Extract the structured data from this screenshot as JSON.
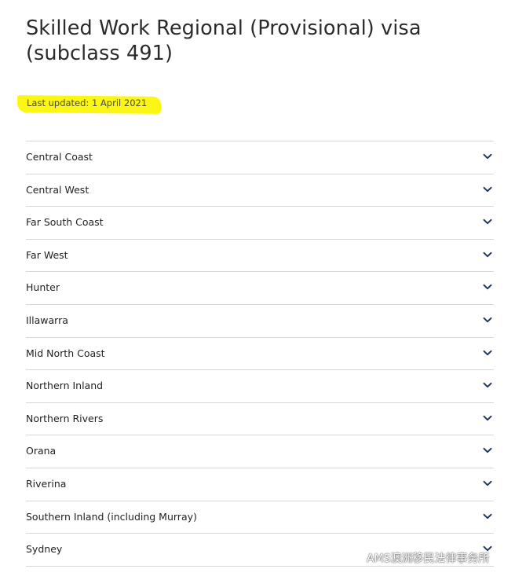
{
  "page": {
    "title": "Skilled Work Regional (Provisional) visa (subclass 491)",
    "last_updated": "Last updated: 1 April 2021",
    "highlight_color": "#fbf612"
  },
  "regions": [
    {
      "label": "Central Coast",
      "icon": "chevron-down-icon"
    },
    {
      "label": "Central West",
      "icon": "chevron-down-icon"
    },
    {
      "label": "Far South Coast",
      "icon": "chevron-down-icon"
    },
    {
      "label": "Far West",
      "icon": "chevron-down-icon"
    },
    {
      "label": "Hunter",
      "icon": "chevron-down-icon"
    },
    {
      "label": "Illawarra",
      "icon": "chevron-down-icon"
    },
    {
      "label": "Mid North Coast",
      "icon": "chevron-down-icon"
    },
    {
      "label": "Northern Inland",
      "icon": "chevron-down-icon"
    },
    {
      "label": "Northern Rivers",
      "icon": "chevron-down-icon"
    },
    {
      "label": "Orana",
      "icon": "chevron-down-icon"
    },
    {
      "label": "Riverina",
      "icon": "chevron-down-icon"
    },
    {
      "label": "Southern Inland (including Murray)",
      "icon": "chevron-down-icon"
    },
    {
      "label": "Sydney",
      "icon": "chevron-down-icon"
    }
  ],
  "watermark": {
    "text": "AMS澳洲移民法律事务所",
    "icon": "wechat-icon"
  },
  "colors": {
    "chevron": "#1f3a5f",
    "divider": "#d6d6d6"
  }
}
